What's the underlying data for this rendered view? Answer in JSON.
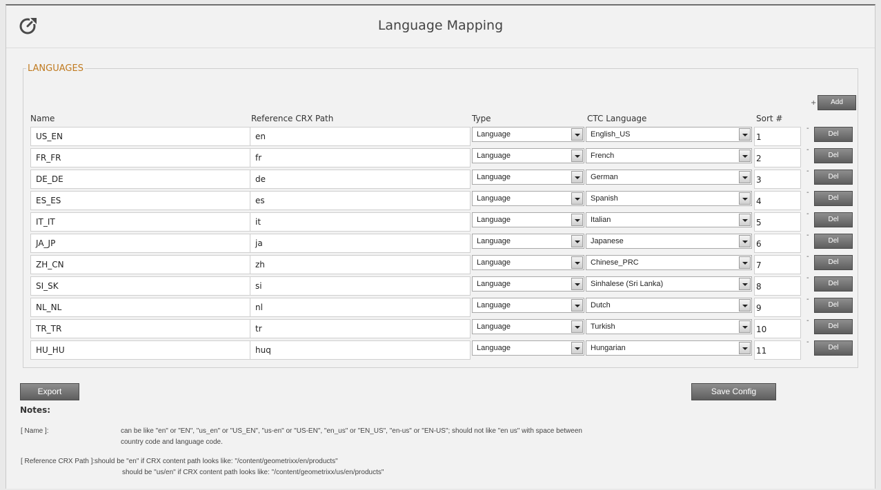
{
  "header": {
    "title": "Language Mapping",
    "logo_icon": "refresh-logo-icon"
  },
  "section": {
    "legend": "LANGUAGES"
  },
  "columns": {
    "name": "Name",
    "path": "Reference CRX Path",
    "type": "Type",
    "ctc": "CTC Language",
    "sort": "Sort #"
  },
  "add": {
    "plus": "+",
    "label": "Add"
  },
  "row_controls": {
    "minus": "-",
    "del_label": "Del"
  },
  "rows": [
    {
      "name": "US_EN",
      "path": "en",
      "type": "Language",
      "ctc": "English_US",
      "sort": "1"
    },
    {
      "name": "FR_FR",
      "path": "fr",
      "type": "Language",
      "ctc": "French",
      "sort": "2"
    },
    {
      "name": "DE_DE",
      "path": "de",
      "type": "Language",
      "ctc": "German",
      "sort": "3"
    },
    {
      "name": "ES_ES",
      "path": "es",
      "type": "Language",
      "ctc": "Spanish",
      "sort": "4"
    },
    {
      "name": "IT_IT",
      "path": "it",
      "type": "Language",
      "ctc": "Italian",
      "sort": "5"
    },
    {
      "name": "JA_JP",
      "path": "ja",
      "type": "Language",
      "ctc": "Japanese",
      "sort": "6"
    },
    {
      "name": "ZH_CN",
      "path": "zh",
      "type": "Language",
      "ctc": "Chinese_PRC",
      "sort": "7"
    },
    {
      "name": "SI_SK",
      "path": "si",
      "type": "Language",
      "ctc": "Sinhalese (Sri Lanka)",
      "sort": "8"
    },
    {
      "name": "NL_NL",
      "path": "nl",
      "type": "Language",
      "ctc": "Dutch",
      "sort": "9"
    },
    {
      "name": "TR_TR",
      "path": "tr",
      "type": "Language",
      "ctc": "Turkish",
      "sort": "10"
    },
    {
      "name": "HU_HU",
      "path": "huq",
      "type": "Language",
      "ctc": "Hungarian",
      "sort": "11"
    }
  ],
  "actions": {
    "export": "Export",
    "save": "Save Config"
  },
  "notes": {
    "heading": "Notes:",
    "name_key": "[ Name ]:",
    "name_line1": "can be like \"en\" or \"EN\", \"us_en\" or \"US_EN\", \"us-en\" or \"US-EN\", \"en_us\" or \"EN_US\", \"en-us\" or \"EN-US\"; should not like \"en us\" with space between",
    "name_line2": "country code and language code.",
    "path_key": "[ Reference CRX Path ]:",
    "path_line1": "should be \"en\" if CRX content path looks like: \"/content/geometrixx/en/products\"",
    "path_line2": "should be \"us/en\" if CRX content path looks like: \"/content/geometrixx/us/en/products\""
  }
}
